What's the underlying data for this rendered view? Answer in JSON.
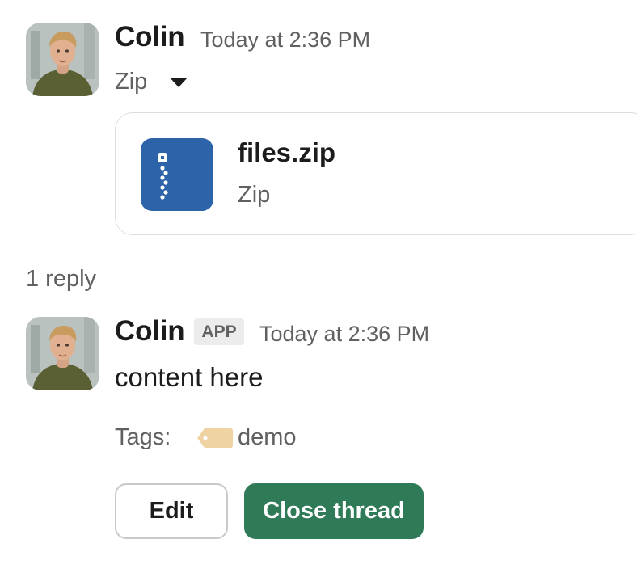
{
  "thread": {
    "reply_count": "1 reply"
  },
  "message1": {
    "sender": "Colin",
    "timestamp": "Today at 2:36 PM",
    "attachment_label": "Zip",
    "file": {
      "name": "files.zip",
      "type": "Zip",
      "icon": "zip-file-icon"
    }
  },
  "message2": {
    "sender": "Colin",
    "badge": "APP",
    "timestamp": "Today at 2:36 PM",
    "text": "content here",
    "tags_label": "Tags:",
    "tag": "demo",
    "tag_icon": "label-tag-icon"
  },
  "actions": {
    "edit_label": "Edit",
    "close_thread_label": "Close thread"
  },
  "colors": {
    "file_icon_bg": "#2d63a8",
    "primary_button": "#2f7a57",
    "tag_icon": "#f0d3a2"
  }
}
